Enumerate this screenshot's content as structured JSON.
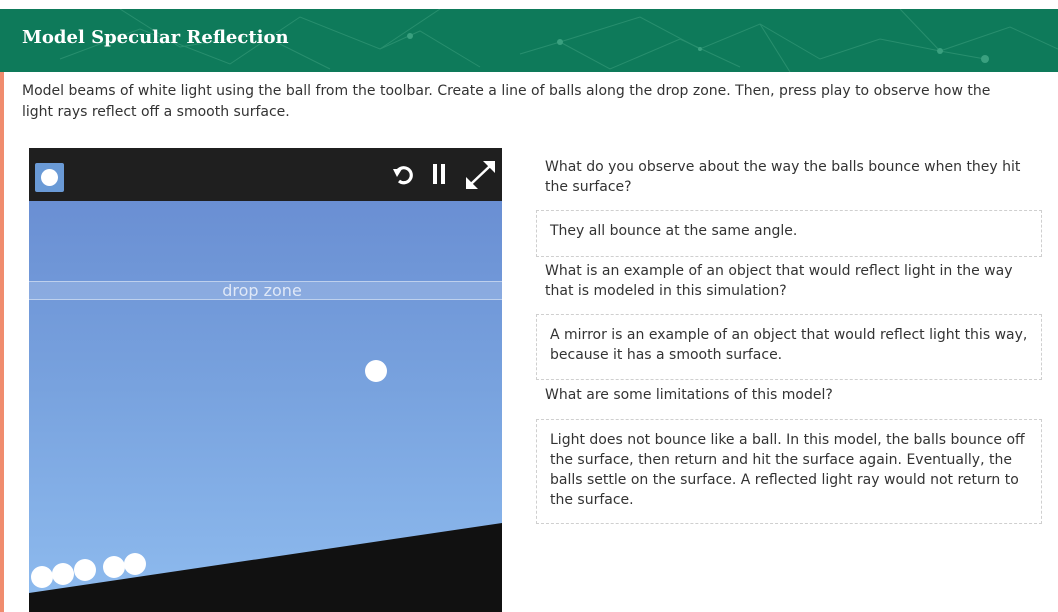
{
  "header": {
    "title": "Model Specular Reflection",
    "bg_color": "#0e7a5a"
  },
  "intro_text": "Model beams of white light using the ball from the toolbar. Create a line of balls along the drop zone. Then, press play to observe how the light rays reflect off a smooth surface.",
  "simulation": {
    "toolbar": {
      "ball_tool_icon": "ball-icon",
      "controls": [
        "reset-icon",
        "pause-icon",
        "fullscreen-icon"
      ]
    },
    "drop_zone_label": "drop zone",
    "sky_color": "#78a2de",
    "surface_color": "#111111"
  },
  "qa": [
    {
      "question": "What do you observe about the way the balls bounce when they hit the surface?",
      "answer": "They all bounce at the same angle."
    },
    {
      "question": "What is an example of an object that would reflect light in the way that is modeled in this simulation?",
      "answer": "A mirror is an example of an object that would reflect light this way, because it has a smooth surface."
    },
    {
      "question": "What are some limitations of this model?",
      "answer": "Light does not bounce like a ball. In this model, the balls bounce off the surface, then return and hit the surface again. Eventually, the balls settle on the surface. A reflected light ray would not return to the surface."
    }
  ]
}
